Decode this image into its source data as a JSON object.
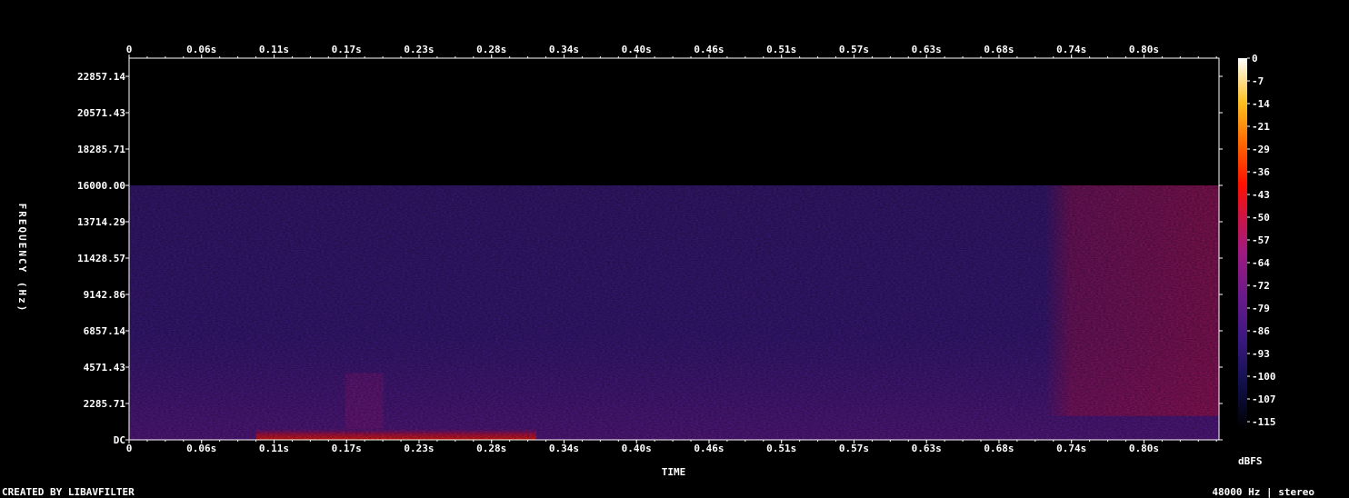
{
  "chart_data": {
    "type": "heatmap",
    "xlabel": "TIME",
    "ylabel": "FREQUENCY (Hz)",
    "x_ticks": [
      "0",
      "0.06s",
      "0.11s",
      "0.17s",
      "0.23s",
      "0.28s",
      "0.34s",
      "0.40s",
      "0.46s",
      "0.51s",
      "0.57s",
      "0.63s",
      "0.68s",
      "0.74s",
      "0.80s"
    ],
    "x_tick_values": [
      0,
      0.057,
      0.114,
      0.171,
      0.228,
      0.285,
      0.342,
      0.399,
      0.456,
      0.513,
      0.57,
      0.627,
      0.684,
      0.741,
      0.798
    ],
    "xlim": [
      0,
      0.857
    ],
    "y_ticks": [
      "DC",
      "2285.71",
      "4571.43",
      "6857.14",
      "9142.86",
      "11428.57",
      "13714.29",
      "16000.00",
      "18285.71",
      "20571.43",
      "22857.14"
    ],
    "y_tick_values": [
      0,
      2285.71,
      4571.43,
      6857.14,
      9142.86,
      11428.57,
      13714.29,
      16000,
      18285.71,
      20571.43,
      22857.14
    ],
    "ylim": [
      0,
      24000
    ],
    "color_scale": {
      "label": "dBFS",
      "ticks": [
        "0",
        "-7",
        "-14",
        "-21",
        "-29",
        "-36",
        "-43",
        "-50",
        "-57",
        "-64",
        "-72",
        "-79",
        "-86",
        "-93",
        "-100",
        "-107",
        "-115"
      ],
      "range": [
        -120,
        0
      ],
      "colors": [
        "#000000",
        "#10104a",
        "#3a1880",
        "#6a1a8a",
        "#a01a80",
        "#d01440",
        "#ff1000",
        "#ff6000",
        "#ffc020",
        "#ffffff"
      ]
    },
    "regions": [
      {
        "t_start": 0,
        "t_end": 0.857,
        "f_start": 16000,
        "f_end": 24000,
        "level_db": -120
      },
      {
        "t_start": 0,
        "t_end": 0.857,
        "f_start": 0,
        "f_end": 16000,
        "level_db": -95
      },
      {
        "t_start": 0.72,
        "t_end": 0.857,
        "f_start": 1500,
        "f_end": 16000,
        "level_db": -70
      },
      {
        "t_start": 0.1,
        "t_end": 0.32,
        "f_start": 0,
        "f_end": 700,
        "level_db": -45
      },
      {
        "t_start": 0.17,
        "t_end": 0.2,
        "f_start": 700,
        "f_end": 4200,
        "level_db": -68
      }
    ],
    "footer_left": "CREATED BY LIBAVFILTER",
    "footer_right": "48000 Hz | stereo"
  }
}
